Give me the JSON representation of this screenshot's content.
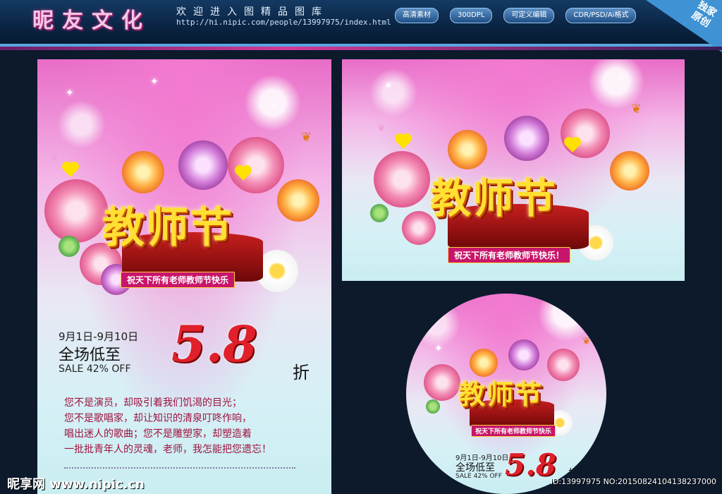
{
  "header": {
    "logo": "昵友文化",
    "tagline": "欢迎进入图精品图库",
    "url": "http://hi.nipic.com/people/13997975/index.html",
    "badges": [
      "高清素材",
      "300DPL",
      "可定义编辑",
      "CDR/PSD/Ai格式"
    ],
    "corner_line1": "独家",
    "corner_line2": "原创"
  },
  "poster": {
    "headline": "教师节",
    "ribbon": "祝天下所有老师教师节快乐",
    "dates": "9月1日-9月10日",
    "promo": "全场低至",
    "sale": "SALE 42% OFF",
    "discount": "5.8",
    "unit": "折",
    "verse": [
      "您不是演员，却吸引着我们饥渴的目光；",
      "您不是歌唱家，却让知识的清泉叮咚作响，",
      "唱出迷人的歌曲；您不是雕塑家，却塑造着",
      "一批批青年人的灵魂，老师，我怎能把您遗忘！"
    ]
  },
  "banner": {
    "headline": "教师节",
    "ribbon": "祝天下所有老师教师节快乐！"
  },
  "circle": {
    "headline": "教师节",
    "ribbon": "祝天下所有老师教师节快乐",
    "dates": "9月1日-9月10日",
    "promo": "全场低至",
    "sale": "SALE 42% OFF",
    "discount": "5.8",
    "unit": "折"
  },
  "footer": {
    "watermark": "昵享网 www.nipic.cn",
    "id_line": "ID:13997975 NO:20150824104138237000"
  },
  "colors": {
    "header_bg": "#0a2443",
    "accent_blue": "#3f93d4",
    "headline_gold": "#ffe033",
    "discount_red": "#e0202a",
    "verse_text": "#a0123e",
    "ribbon_pink": "#c8156a"
  },
  "icons": [
    "butterfly-icon",
    "heart-icon",
    "sparkle-icon",
    "flower-icon"
  ]
}
